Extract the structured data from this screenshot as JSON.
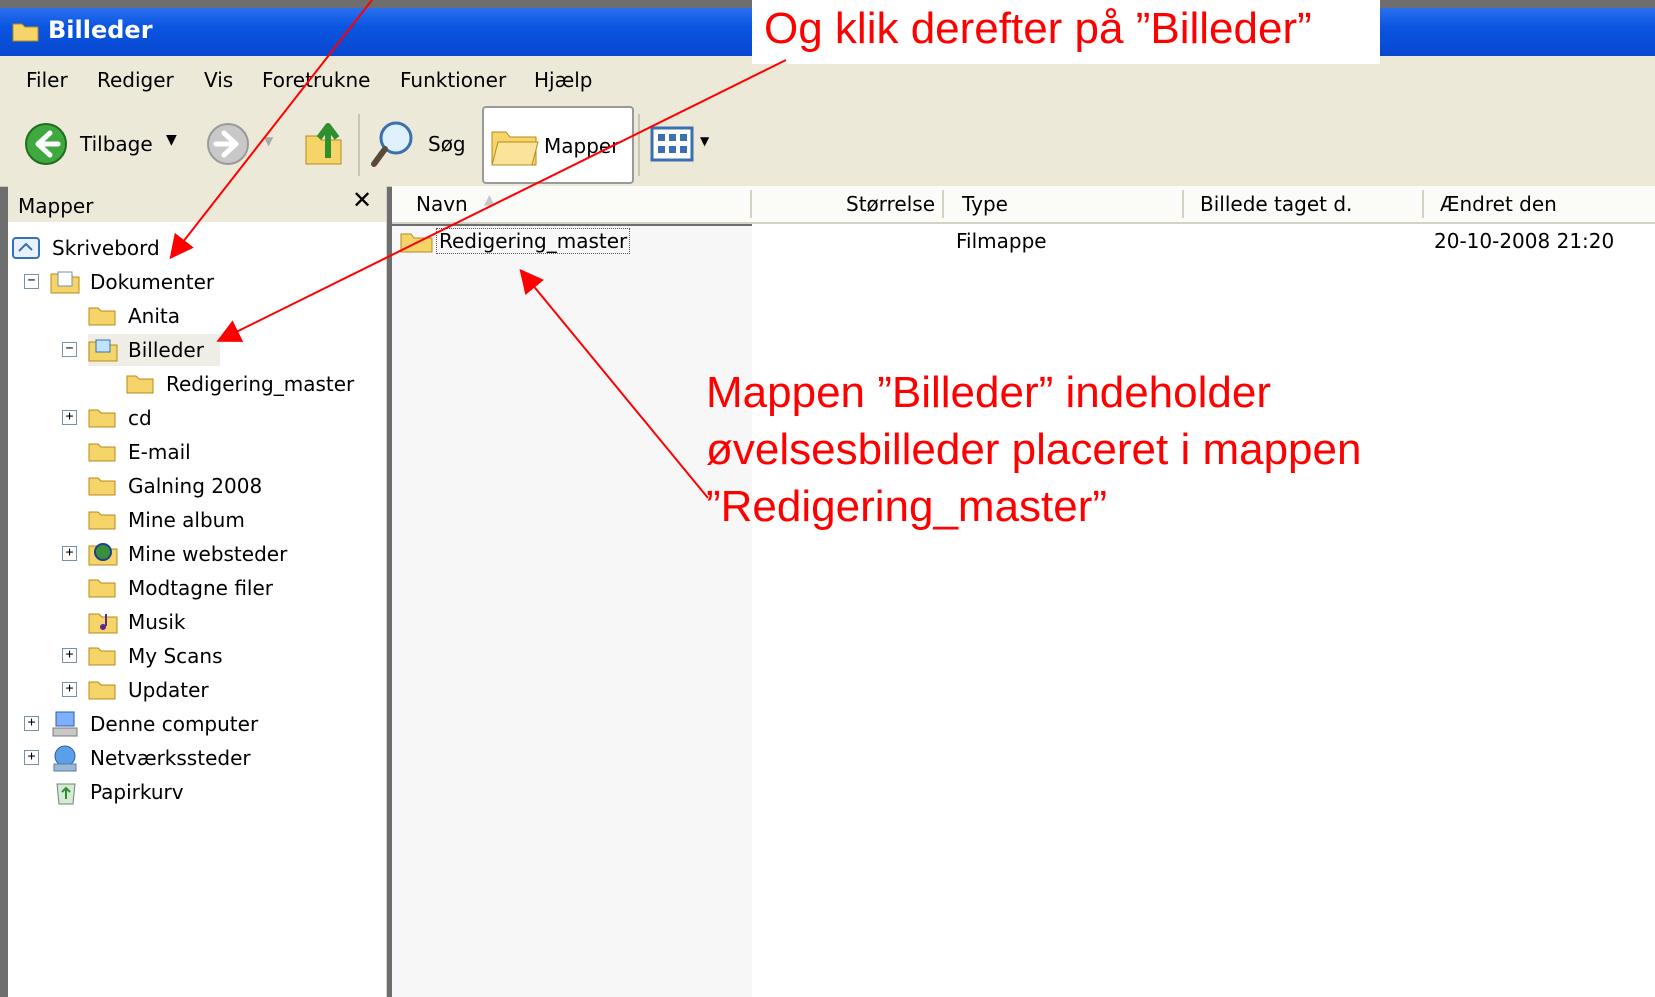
{
  "window": {
    "title": "Billeder"
  },
  "menu": [
    "Filer",
    "Rediger",
    "Vis",
    "Foretrukne",
    "Funktioner",
    "Hjælp"
  ],
  "toolbar": {
    "back_label": "Tilbage",
    "search_label": "Søg",
    "folders_label": "Mapper"
  },
  "folder_pane": {
    "title": "Mapper",
    "tree": [
      {
        "label": "Skrivebord"
      },
      {
        "label": "Dokumenter"
      },
      {
        "label": "Anita"
      },
      {
        "label": "Billeder"
      },
      {
        "label": "Redigering_master"
      },
      {
        "label": "cd"
      },
      {
        "label": "E-mail"
      },
      {
        "label": "Galning 2008"
      },
      {
        "label": "Mine album"
      },
      {
        "label": "Mine websteder"
      },
      {
        "label": "Modtagne filer"
      },
      {
        "label": "Musik"
      },
      {
        "label": "My Scans"
      },
      {
        "label": "Updater"
      },
      {
        "label": "Denne computer"
      },
      {
        "label": "Netværkssteder"
      },
      {
        "label": "Papirkurv"
      }
    ]
  },
  "file_list": {
    "columns": [
      "Navn",
      "Størrelse",
      "Type",
      "Billede taget d.",
      "Ændret den"
    ],
    "rows": [
      {
        "name": "Redigering_master",
        "size": "",
        "type": "Filmappe",
        "taken": "",
        "modified": "20-10-2008 21:20"
      }
    ]
  },
  "annotations": {
    "callout_top": "Og klik derefter på ”Billeder”",
    "callout_body": [
      "Mappen ”Billeder” indeholder",
      "øvelsesbilleder placeret i mappen",
      "”Redigering_master”"
    ],
    "color": "#ff0000"
  },
  "colors": {
    "titlebar": "#0a55e0",
    "chrome": "#ece9d8",
    "folder": "#f5d46a"
  }
}
